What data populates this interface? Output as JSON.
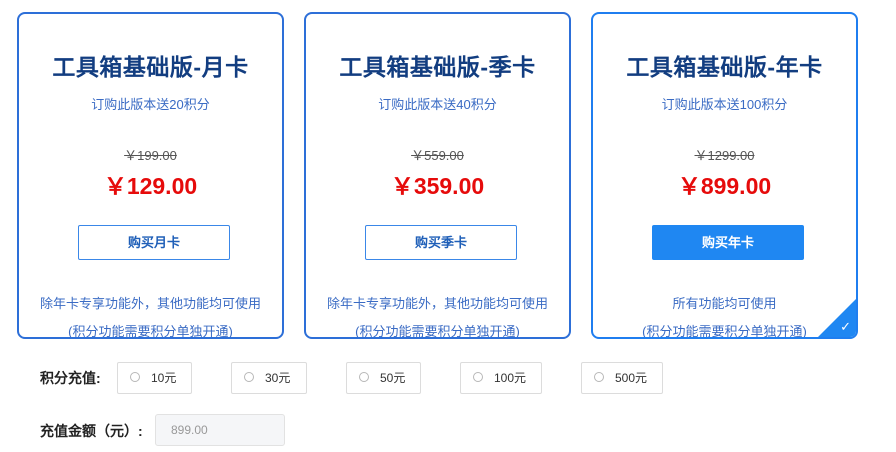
{
  "cards": [
    {
      "title": "工具箱基础版-月卡",
      "subtitle": "订购此版本送20积分",
      "original_price": "￥199.00",
      "price": "￥129.00",
      "button_label": "购买月卡",
      "description": "除年卡专享功能外，其他功能均可使用",
      "note": "(积分功能需要积分单独开通)"
    },
    {
      "title": "工具箱基础版-季卡",
      "subtitle": "订购此版本送40积分",
      "original_price": "￥559.00",
      "price": "￥359.00",
      "button_label": "购买季卡",
      "description": "除年卡专享功能外，其他功能均可使用",
      "note": "(积分功能需要积分单独开通)"
    },
    {
      "title": "工具箱基础版-年卡",
      "subtitle": "订购此版本送100积分",
      "original_price": "￥1299.00",
      "price": "￥899.00",
      "button_label": "购买年卡",
      "description": "所有功能均可使用",
      "note": "(积分功能需要积分单独开通)",
      "selected": true
    }
  ],
  "recharge": {
    "label": "积分充值:",
    "options": [
      "10元",
      "30元",
      "50元",
      "100元",
      "500元"
    ]
  },
  "amount": {
    "label": "充值金额（元）:",
    "value": "899.00"
  },
  "colors": {
    "accent": "#1f87f2",
    "price": "#e60b0b",
    "title": "#123d80",
    "text_blue": "#3a6bc4"
  },
  "icons": {
    "selected_corner": "check-icon",
    "radio": "radio-icon"
  }
}
